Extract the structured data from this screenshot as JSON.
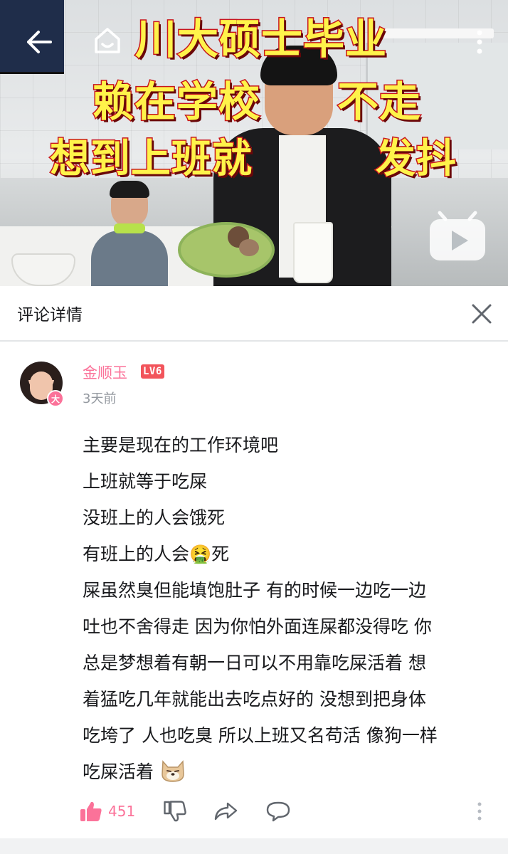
{
  "video": {
    "overlay_title_lines": [
      "川大硕士毕业",
      "赖在学校",
      "不走",
      "想到上班就",
      "发抖"
    ],
    "icons": {
      "back": "back-arrow-icon",
      "home": "home-tv-icon",
      "more": "more-vertical-icon",
      "play_logo": "bilibili-play-icon"
    },
    "colors": {
      "title_fill": "#fff34a",
      "title_stroke": "#c8171c"
    }
  },
  "header": {
    "title": "评论详情",
    "close_icon": "close-icon"
  },
  "comment": {
    "user": {
      "name": "金顺玉",
      "level": "LV6",
      "avatar_badge": "大",
      "name_color": "#fb7299"
    },
    "time": "3天前",
    "lines": [
      "主要是现在的工作环境吧",
      "上班就等于吃屎",
      "没班上的人会饿死",
      "有班上的人会🤮死",
      "屎虽然臭但能填饱肚子 有的时候一边吃一边",
      "吐也不舍得走 因为你怕外面连屎都没得吃 你",
      "总是梦想着有朝一日可以不用靠吃屎活着 想",
      "着猛吃几年就能出去吃点好的 没想到把身体",
      "吃垮了 人也吃臭 所以上班又名苟活 像狗一样",
      "吃屎活着"
    ],
    "trailing_emoji": "doge-emoji",
    "actions": {
      "like_count": "451",
      "like_icon": "thumbs-up-icon",
      "dislike_icon": "thumbs-down-icon",
      "share_icon": "share-arrow-icon",
      "reply_icon": "speech-bubble-icon",
      "more_icon": "more-vertical-icon"
    }
  }
}
